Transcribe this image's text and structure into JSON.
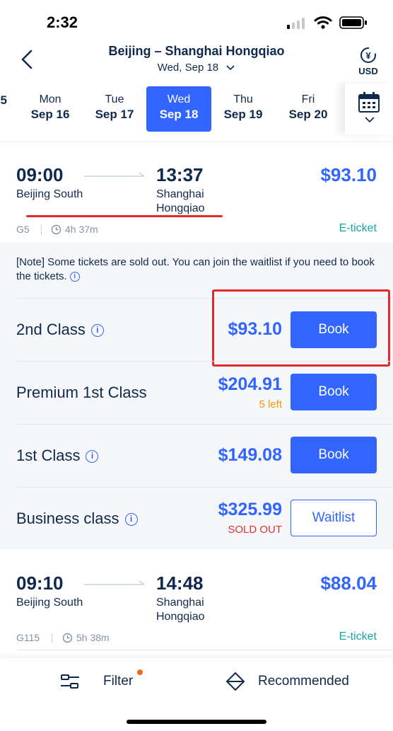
{
  "status_bar": {
    "time": "2:32"
  },
  "header": {
    "title": "Beijing – Shanghai Hongqiao",
    "subtitle": "Wed, Sep 18",
    "currency": "USD"
  },
  "date_tabs": [
    {
      "weekday": "",
      "date": "5",
      "active": false
    },
    {
      "weekday": "Mon",
      "date": "Sep 16",
      "active": false
    },
    {
      "weekday": "Tue",
      "date": "Sep 17",
      "active": false
    },
    {
      "weekday": "Wed",
      "date": "Sep 18",
      "active": true
    },
    {
      "weekday": "Thu",
      "date": "Sep 19",
      "active": false
    },
    {
      "weekday": "Fri",
      "date": "Sep 20",
      "active": false
    }
  ],
  "trains": [
    {
      "depart_time": "09:00",
      "depart_station": "Beijing South",
      "arrive_time": "13:37",
      "arrive_station_line1": "Shanghai",
      "arrive_station_line2": "Hongqiao",
      "price": "$93.10",
      "train_no": "G5",
      "duration": "4h 37m",
      "ticket_type": "E-ticket"
    },
    {
      "depart_time": "09:10",
      "depart_station": "Beijing South",
      "arrive_time": "14:48",
      "arrive_station_line1": "Shanghai",
      "arrive_station_line2": "Hongqiao",
      "price": "$88.04",
      "train_no": "G115",
      "duration": "5h 38m",
      "ticket_type": "E-ticket"
    }
  ],
  "note": "[Note] Some tickets are sold out. You can join the waitlist if you need to book the tickets.",
  "seat_classes": [
    {
      "name": "2nd Class",
      "price": "$93.10",
      "sub": "",
      "button": "Book"
    },
    {
      "name": "Premium 1st Class",
      "price": "$204.91",
      "sub": "5 left",
      "button": "Book"
    },
    {
      "name": "1st Class",
      "price": "$149.08",
      "sub": "",
      "button": "Book"
    },
    {
      "name": "Business class",
      "price": "$325.99",
      "sub": "SOLD OUT",
      "button": "Waitlist"
    }
  ],
  "bottom_bar": {
    "filter": "Filter",
    "sort": "Recommended"
  },
  "colors": {
    "accent": "#3264ff",
    "etk": "#12a6a6",
    "left": "#f29d00",
    "sold_out": "#e0312f",
    "annotation_red": "#e32a2a"
  }
}
